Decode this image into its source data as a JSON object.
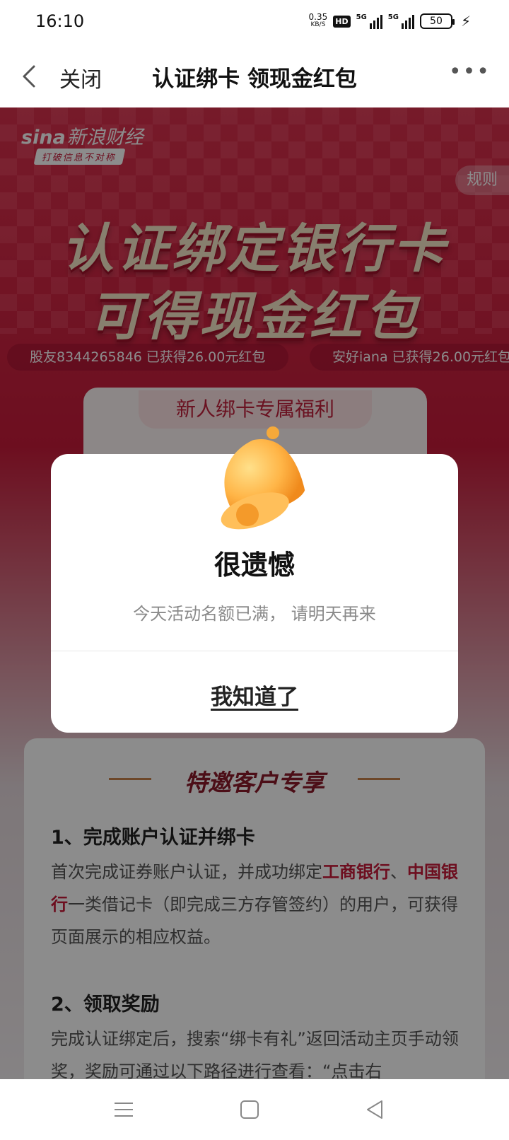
{
  "status_bar": {
    "time": "16:10",
    "net_speed_value": "0.35",
    "net_speed_unit": "KB/S",
    "hd_label": "HD",
    "signal1_label": "5G",
    "signal2_label": "5G",
    "battery": "50"
  },
  "nav": {
    "close_label": "关闭",
    "title": "认证绑卡 领现金红包"
  },
  "banner": {
    "brand_name": "新浪财经",
    "brand_latin": "sina",
    "brand_slogan": "打破信息不对称",
    "rules_label": "规则",
    "headline_line1": "认证绑定银行卡",
    "headline_line2": "可得现金红包",
    "ticker": [
      "股友8344265846 已获得26.00元红包",
      "安好iana 已获得26.00元红包"
    ]
  },
  "benefit": {
    "title": "新人绑卡专属福利"
  },
  "dialog": {
    "title": "很遗憾",
    "message": "今天活动名额已满， 请明天再来",
    "button": "我知道了"
  },
  "rules": {
    "heading": "特邀客户专享",
    "step1_title": "1、完成账户认证并绑卡",
    "step1_text_a": "首次完成证券账户认证，并成功绑定",
    "step1_bank1": "工商银行",
    "step1_sep": "、",
    "step1_bank2": "中国银行",
    "step1_text_b": "一类借记卡（即完成三方存管签约）的用户，可获得页面展示的相应权益。",
    "step2_title": "2、领取奖励",
    "step2_text": "完成认证绑定后，搜索“绑卡有礼”返回活动主页手动领奖，奖励可通过以下路径进行查看：“点击右"
  },
  "colors": {
    "accent_red": "#c71b3a",
    "headline_gold": "#f6e7c9"
  }
}
